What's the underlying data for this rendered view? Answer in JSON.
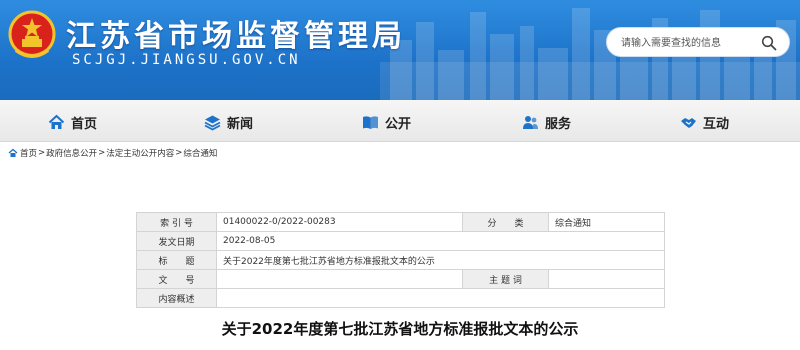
{
  "header": {
    "title": "江苏省市场监督管理局",
    "domain": "SCJGJ.JIANGSU.GOV.CN",
    "emblem_icon": "national-emblem-icon",
    "background_color": "#1d73c9"
  },
  "search": {
    "placeholder": "请输入需要查找的信息",
    "icon": "search-icon"
  },
  "nav": {
    "items": [
      {
        "label": "首页",
        "icon": "home-icon"
      },
      {
        "label": "新闻",
        "icon": "layers-icon"
      },
      {
        "label": "公开",
        "icon": "book-icon"
      },
      {
        "label": "服务",
        "icon": "people-icon"
      },
      {
        "label": "互动",
        "icon": "handshake-icon"
      }
    ]
  },
  "breadcrumb": {
    "icon": "home-icon",
    "items": [
      "首页",
      "政府信息公开",
      "法定主动公开内容",
      "综合通知"
    ],
    "separator": ">"
  },
  "info_table": {
    "index_label": "索 引 号",
    "index_value": "01400022-0/2022-00283",
    "category_label": "分　　类",
    "category_value": "综合通知",
    "date_label": "发文日期",
    "date_value": "2022-08-05",
    "title_label": "标　　题",
    "title_value": "关于2022年度第七批江苏省地方标准报批文本的公示",
    "docno_label": "文　　号",
    "docno_value": "",
    "subject_label": "主 题 词",
    "subject_value": "",
    "summary_label": "内容概述",
    "summary_value": ""
  },
  "document": {
    "title": "关于2022年度第七批江苏省地方标准报批文本的公示"
  }
}
